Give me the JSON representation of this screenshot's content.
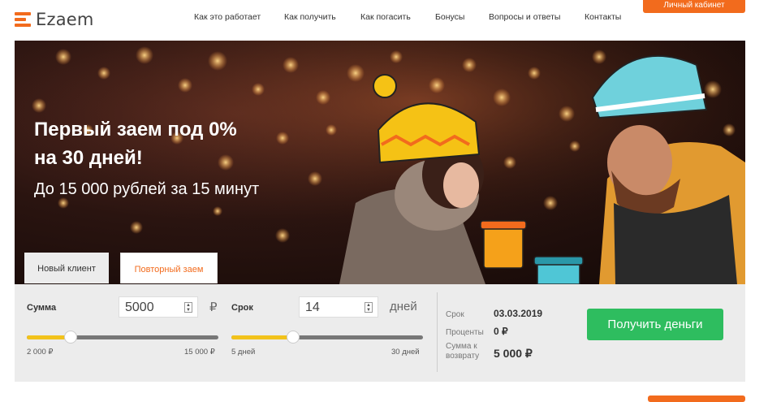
{
  "brand": {
    "name": "Ezaem",
    "accent": "#f26b1d"
  },
  "nav": [
    {
      "label": "Как это работает"
    },
    {
      "label": "Как получить"
    },
    {
      "label": "Как погасить"
    },
    {
      "label": "Бонусы"
    },
    {
      "label": "Вопросы и ответы"
    },
    {
      "label": "Контакты"
    }
  ],
  "header": {
    "cabinet_label": "Личный кабинет"
  },
  "hero": {
    "title_line1": "Первый заем под 0%",
    "title_line2": "на 30 дней!",
    "subtitle": "До 15 000 рублей за 15 минут"
  },
  "tabs": {
    "new_client": "Новый клиент",
    "repeat_loan": "Повторный заем"
  },
  "calculator": {
    "amount": {
      "label": "Сумма",
      "value": "5000",
      "unit": "₽",
      "min": "2 000 ₽",
      "max": "15 000 ₽",
      "level": 0.23
    },
    "term": {
      "label": "Срок",
      "value": "14",
      "unit": "дней",
      "min": "5 дней",
      "max": "30 дней",
      "level": 0.32
    },
    "info": {
      "term_label": "Срок",
      "term_value": "03.03.2019",
      "percent_label": "Проценты",
      "percent_value": "0 ₽",
      "total_label_line1": "Сумма к",
      "total_label_line2": "возврату",
      "total_value": "5 000 ₽"
    },
    "submit_label": "Получить деньги",
    "submit_color": "#2ebd5f"
  }
}
